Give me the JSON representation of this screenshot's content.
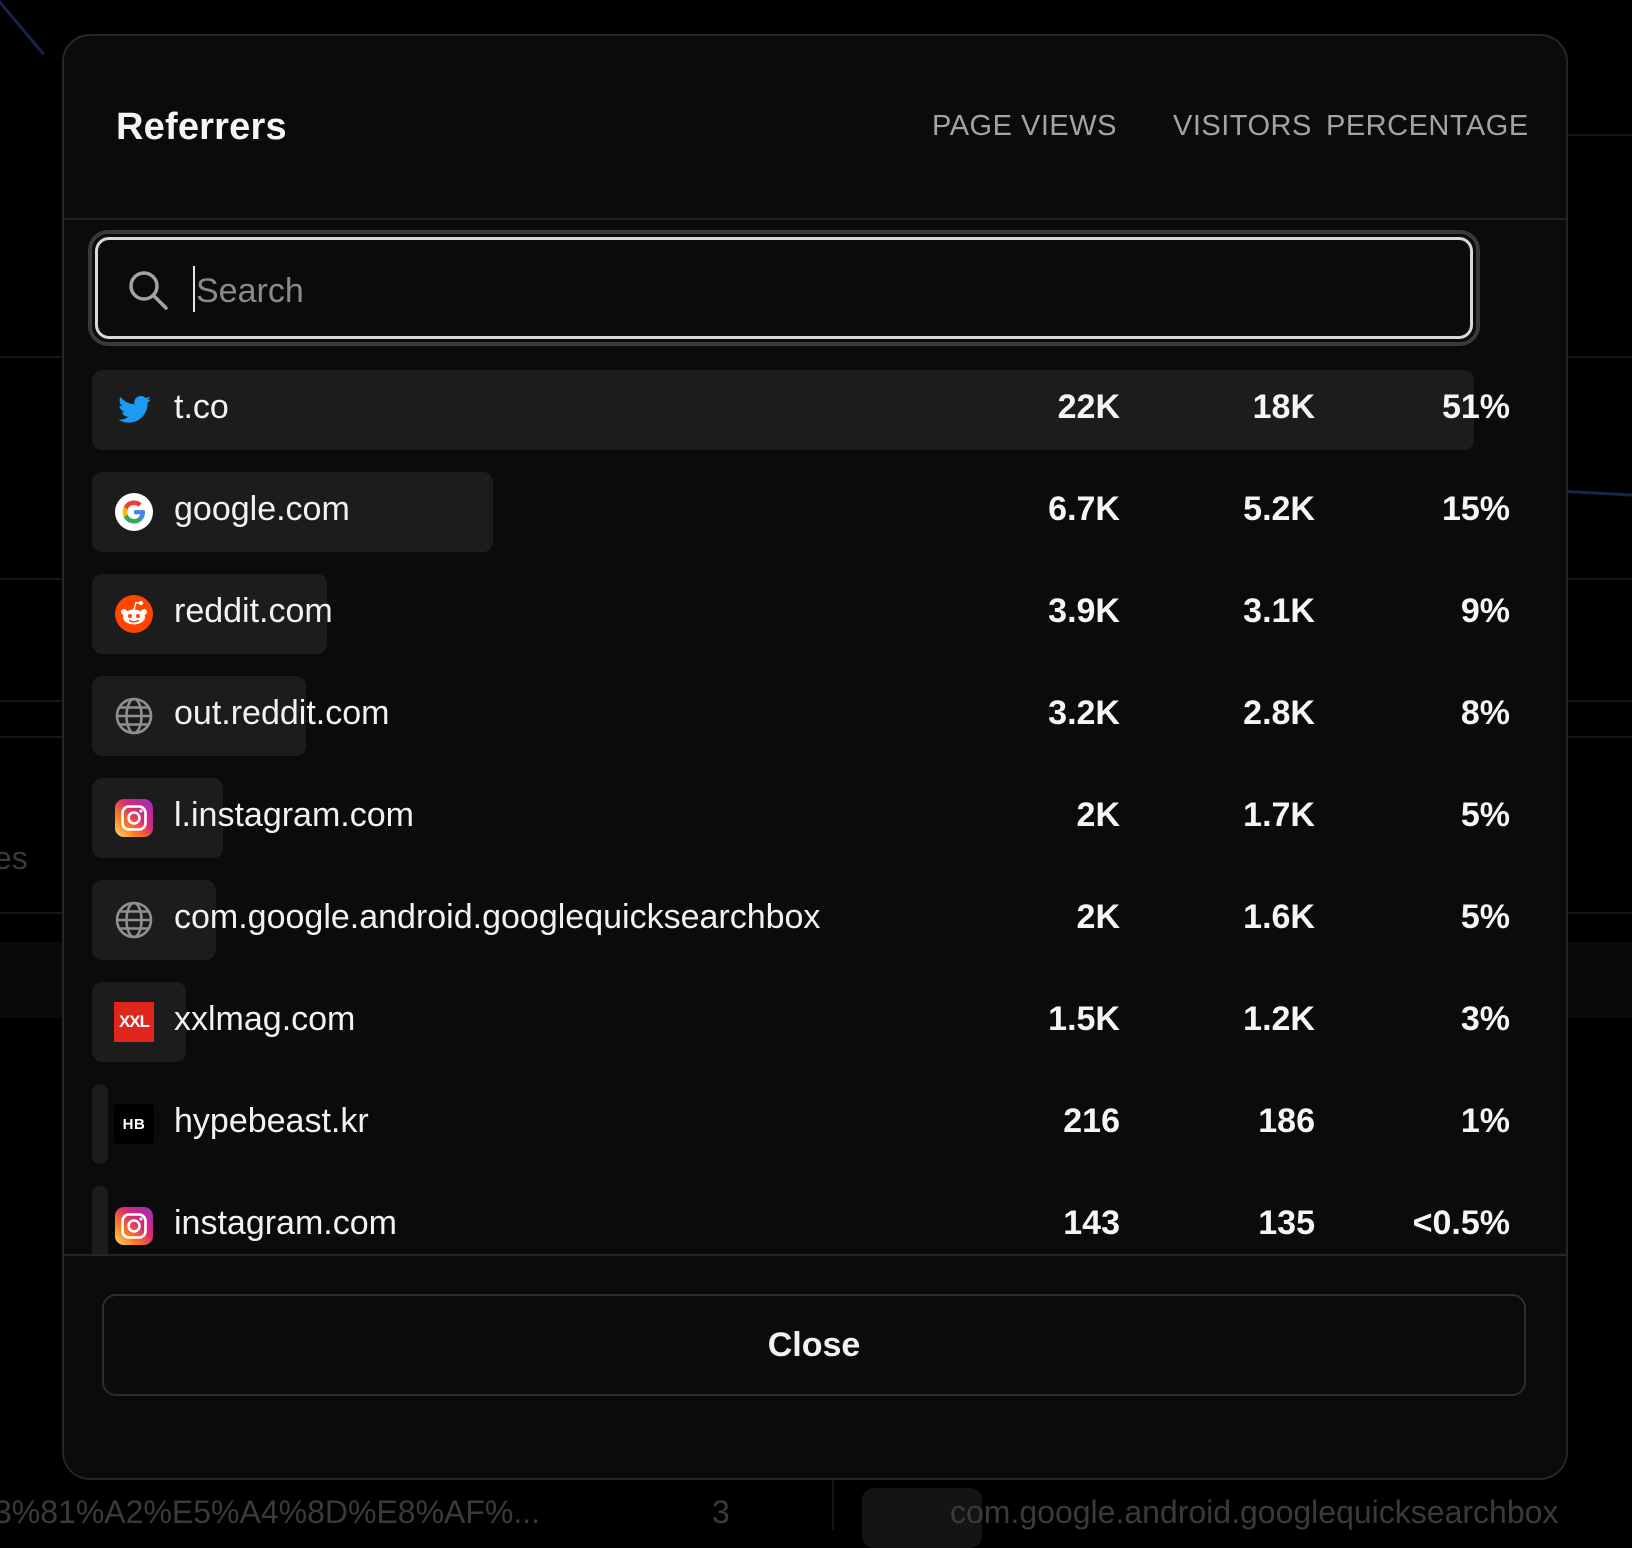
{
  "modal": {
    "title": "Referrers",
    "columns": {
      "page_views": "PAGE VIEWS",
      "visitors": "VISITORS",
      "percentage": "PERCENTAGE"
    },
    "search": {
      "placeholder": "Search",
      "value": ""
    },
    "rows": [
      {
        "name": "t.co",
        "icon": "twitter-icon",
        "page_views": "22K",
        "visitors": "18K",
        "percentage": "51%",
        "share": 1.0
      },
      {
        "name": "google.com",
        "icon": "google-icon",
        "page_views": "6.7K",
        "visitors": "5.2K",
        "percentage": "15%",
        "share": 0.29
      },
      {
        "name": "reddit.com",
        "icon": "reddit-icon",
        "page_views": "3.9K",
        "visitors": "3.1K",
        "percentage": "9%",
        "share": 0.17
      },
      {
        "name": "out.reddit.com",
        "icon": "globe-icon",
        "page_views": "3.2K",
        "visitors": "2.8K",
        "percentage": "8%",
        "share": 0.155
      },
      {
        "name": "l.instagram.com",
        "icon": "instagram-icon",
        "page_views": "2K",
        "visitors": "1.7K",
        "percentage": "5%",
        "share": 0.095
      },
      {
        "name": "com.google.android.googlequicksearchbox",
        "icon": "globe-icon",
        "page_views": "2K",
        "visitors": "1.6K",
        "percentage": "5%",
        "share": 0.09
      },
      {
        "name": "xxlmag.com",
        "icon": "xxl-icon",
        "page_views": "1.5K",
        "visitors": "1.2K",
        "percentage": "3%",
        "share": 0.068
      },
      {
        "name": "hypebeast.kr",
        "icon": "hypebeast-icon",
        "page_views": "216",
        "visitors": "186",
        "percentage": "1%",
        "share": 0.01
      },
      {
        "name": "instagram.com",
        "icon": "instagram-icon",
        "page_views": "143",
        "visitors": "135",
        "percentage": "<0.5%",
        "share": 0.007
      }
    ],
    "close_label": "Close"
  },
  "background": {
    "bottom_left_text": "3%81%A2%E5%A4%8D%E8%AF%...",
    "bottom_mid_text": "3",
    "bottom_right_text": "com.google.android.googlequicksearchbox",
    "left_fragment": "es"
  }
}
